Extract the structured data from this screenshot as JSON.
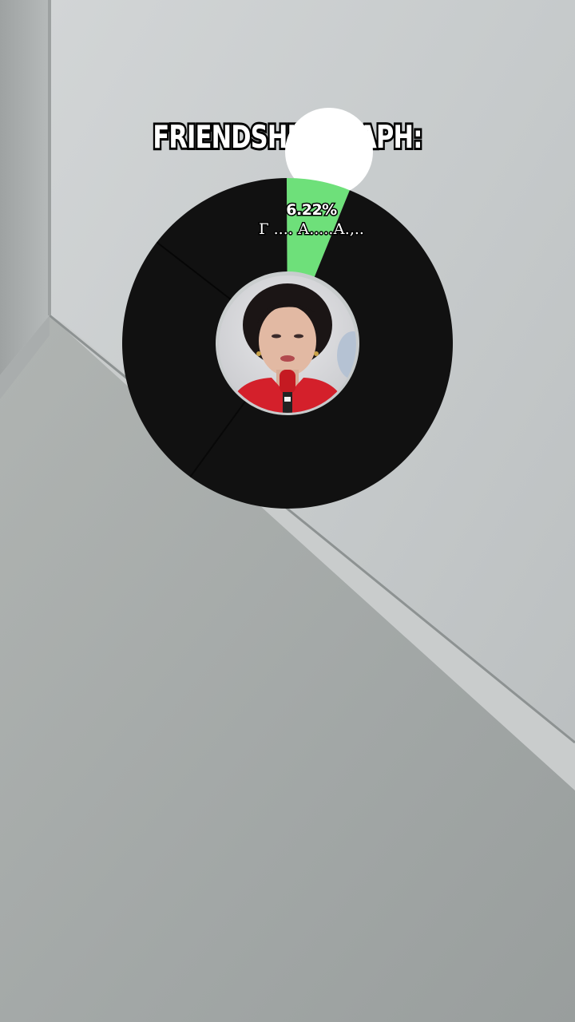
{
  "header": {
    "title": "FRIENDSHIP GRAPH:"
  },
  "chart_data": {
    "type": "pie",
    "style": "donut",
    "slices": [
      {
        "label": "Г .... А.....А.,..",
        "percent": 6.22,
        "percent_label": "6.22%",
        "color": "#6ee07a"
      },
      {
        "label": "",
        "percent": 93.78,
        "color": "#111111"
      }
    ]
  },
  "center": {
    "avatar": "woman-with-microphone-photo"
  },
  "colors": {
    "ring": "#111111",
    "highlight_slice": "#6ee07a",
    "wall": "#c4c8c9",
    "floor": "#a7acab"
  }
}
